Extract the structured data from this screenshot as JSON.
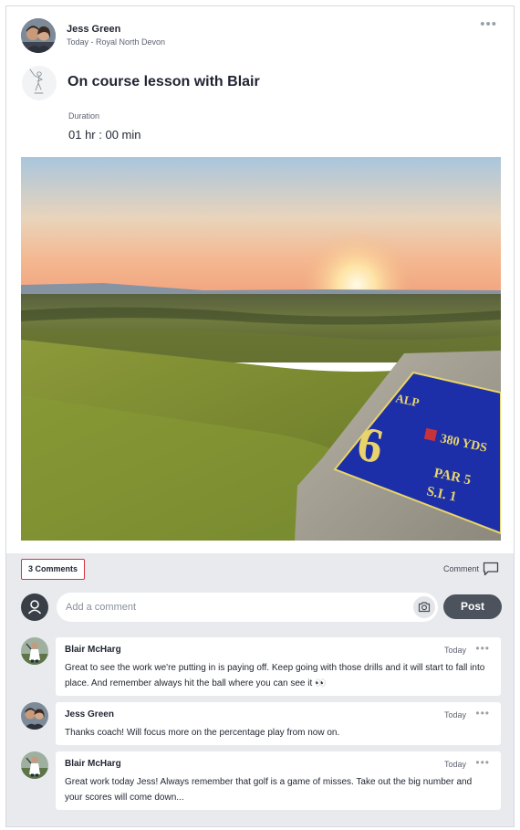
{
  "post": {
    "author": "Jess Green",
    "meta": "Today - Royal North Devon",
    "more_label": "•••",
    "title": "On course lesson with Blair",
    "duration_label": "Duration",
    "duration_value": "01 hr : 00 min"
  },
  "photo": {
    "tee_plaque": {
      "course": "ALP",
      "hole": "6",
      "yards": "380 YDS",
      "par": "PAR 5",
      "si": "S.I. 1"
    }
  },
  "comments_bar": {
    "count_label": "3 Comments",
    "comment_link_label": "Comment",
    "input_placeholder": "Add a comment",
    "post_label": "Post"
  },
  "comments": [
    {
      "name": "Blair McHarg",
      "time": "Today",
      "more": "•••",
      "text": "Great to see the work we're putting in is paying off. Keep going with those drills and it will start to fall into place. And remember always hit the ball where you can see it 👀"
    },
    {
      "name": "Jess Green",
      "time": "Today",
      "more": "•••",
      "text": "Thanks coach! Will focus more on the percentage play from now on."
    },
    {
      "name": "Blair McHarg",
      "time": "Today",
      "more": "•••",
      "text": "Great work today Jess! Always remember that golf is a game of misses. Take out the big number and your scores will come down..."
    }
  ],
  "colors": {
    "accent_red": "#d7353f",
    "post_button": "#4d535d",
    "panel_bg": "#e8eaed",
    "plaque_blue": "#1d2fa8",
    "plaque_gold": "#e8d46a"
  }
}
